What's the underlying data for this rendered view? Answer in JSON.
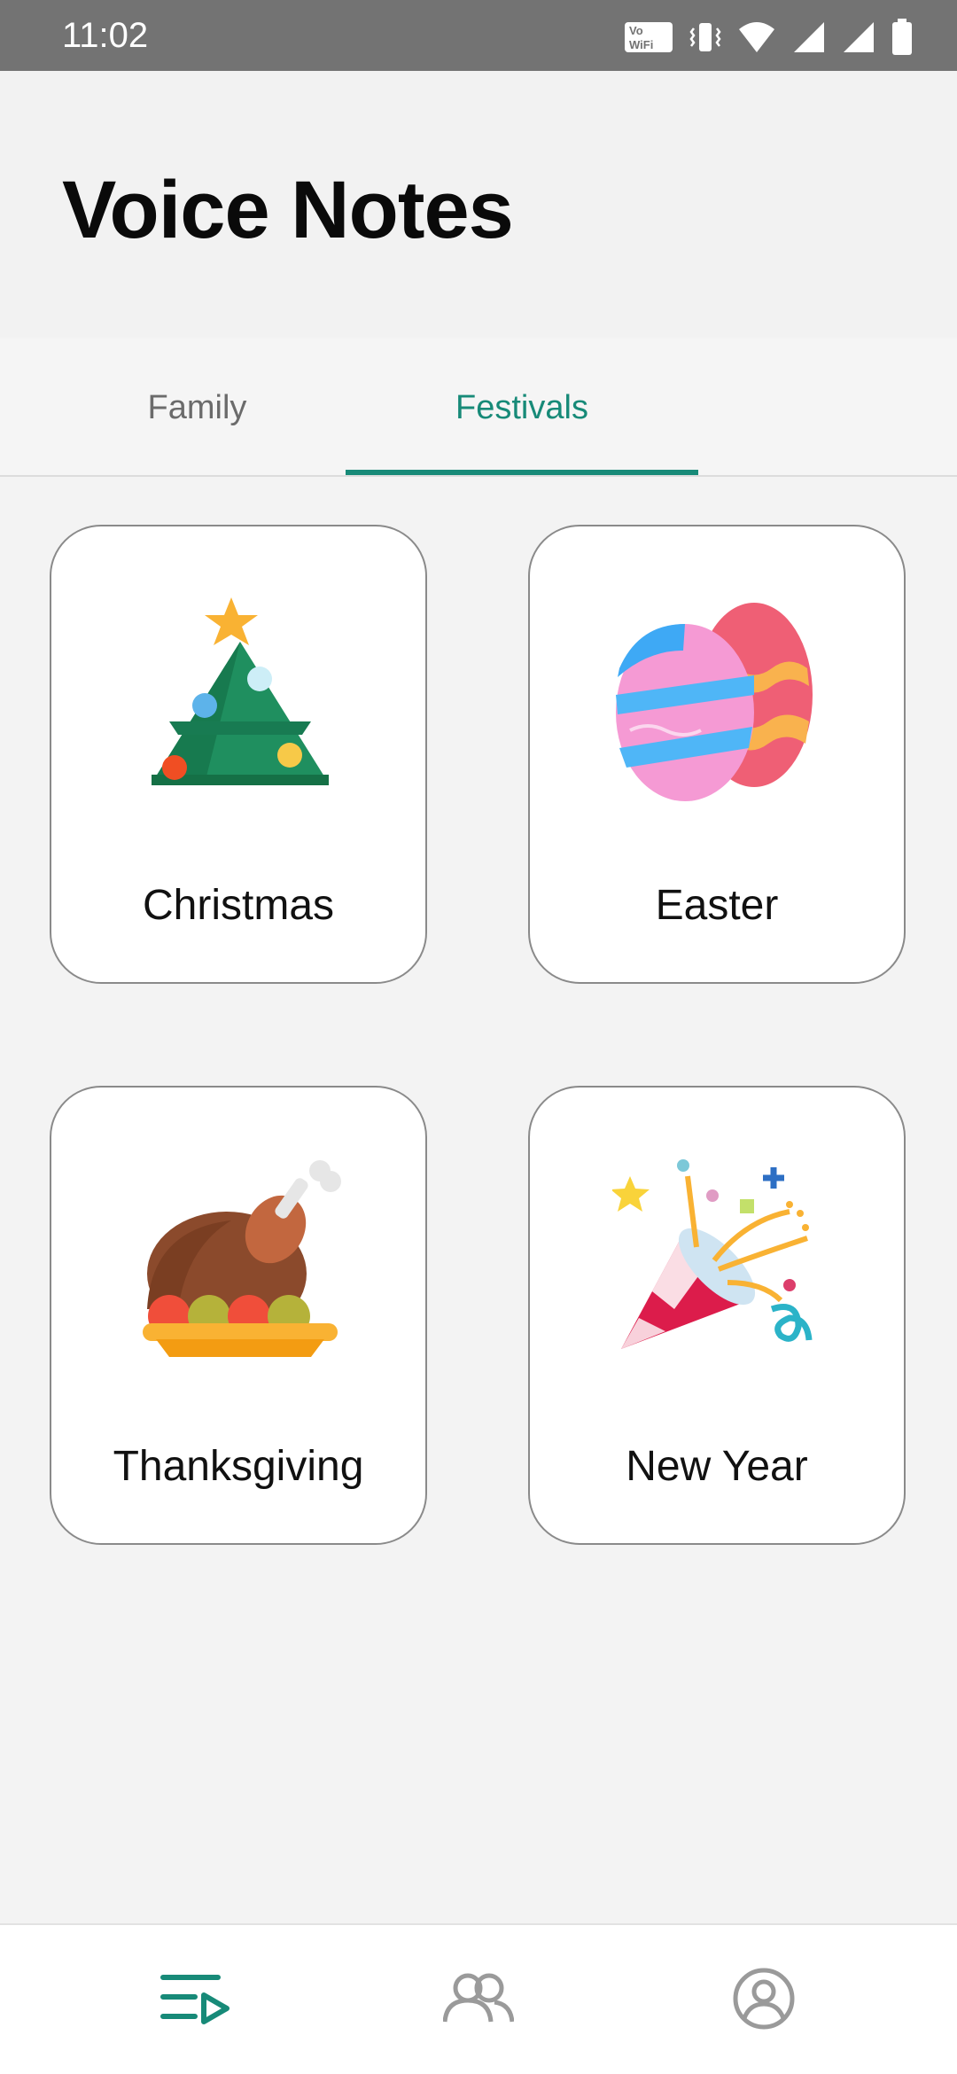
{
  "status_bar": {
    "time": "11:02",
    "icons": [
      "vowifi-icon",
      "vibrate-icon",
      "wifi-icon",
      "signal-icon",
      "signal-icon",
      "battery-icon"
    ]
  },
  "header": {
    "title": "Voice Notes"
  },
  "tabs": [
    {
      "label": "Family",
      "selected": false
    },
    {
      "label": "Festivals",
      "selected": true
    }
  ],
  "cards": [
    {
      "label": "Christmas",
      "icon": "christmas-tree-icon"
    },
    {
      "label": "Easter",
      "icon": "easter-eggs-icon"
    },
    {
      "label": "Thanksgiving",
      "icon": "roast-turkey-icon"
    },
    {
      "label": "New Year",
      "icon": "party-popper-icon"
    }
  ],
  "bottom_nav": {
    "items": [
      {
        "icon": "playlist-play-icon",
        "selected": true
      },
      {
        "icon": "people-icon",
        "selected": false
      },
      {
        "icon": "profile-icon",
        "selected": false
      }
    ]
  },
  "colors": {
    "accent": "#178a78",
    "status_bar": "#737373",
    "background": "#f3f3f3"
  }
}
